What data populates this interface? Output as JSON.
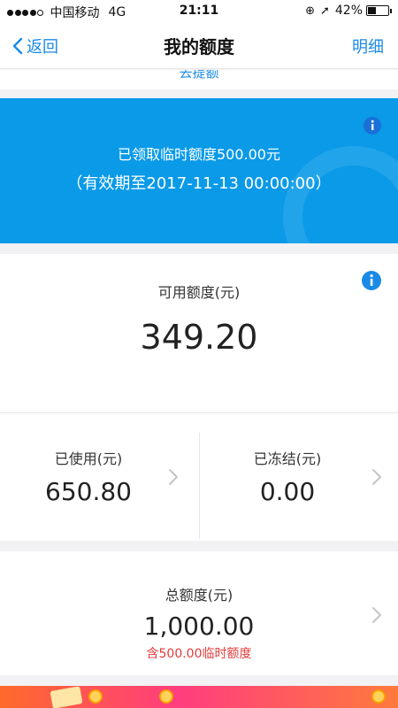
{
  "status_bar": {
    "carrier": "中国移动",
    "network": "4G",
    "time": "21:11",
    "battery": "42%",
    "battery_level": 0.42
  },
  "nav": {
    "back_label": "返回",
    "title": "我的额度",
    "detail_label": "明细"
  },
  "peek": {
    "text": "去提额"
  },
  "banner": {
    "line1": "已领取临时额度500.00元",
    "line2": "（有效期至2017-11-13 00:00:00）"
  },
  "available": {
    "label": "可用额度(元)",
    "value": "349.20"
  },
  "used": {
    "label": "已使用(元)",
    "value": "650.80"
  },
  "frozen": {
    "label": "已冻结(元)",
    "value": "0.00"
  },
  "total": {
    "label": "总额度(元)",
    "value": "1,000.00",
    "sub": "含500.00临时额度"
  },
  "colors": {
    "accent": "#1a8ae6",
    "banner": "#0a9ae8",
    "warning": "#e23b3b"
  }
}
